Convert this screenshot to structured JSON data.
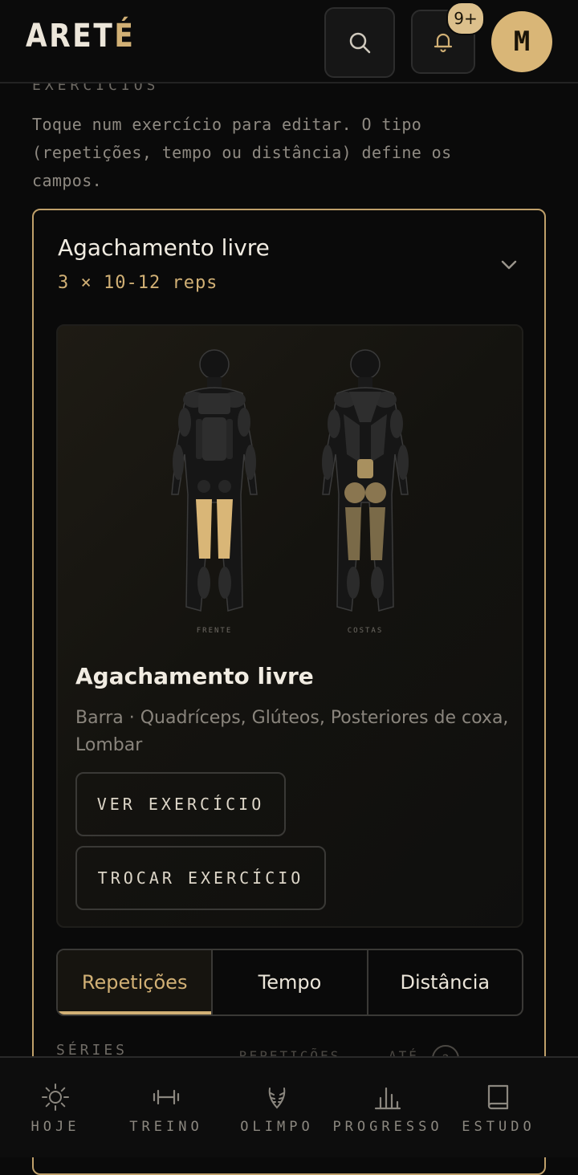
{
  "app": {
    "logo_main": "ARET",
    "logo_accent": "É"
  },
  "header": {
    "notification_badge": "9+",
    "avatar_initial": "M"
  },
  "section": {
    "label": "EXERCÍCIOS",
    "intro": "Toque num exercício para editar. O tipo (repetições, tempo ou distância) define os campos."
  },
  "exercise": {
    "title": "Agachamento livre",
    "prescription": "3 × 10-12 reps",
    "diagram": {
      "front_label": "FRENTE",
      "back_label": "COSTAS"
    },
    "detail_title": "Agachamento livre",
    "detail_meta": "Barra · Quadríceps, Glúteos, Posteriores de coxa, Lombar",
    "view_button": "VER EXERCÍCIO",
    "swap_button": "TROCAR EXERCÍCIO",
    "tabs": [
      {
        "label": "Repetições",
        "active": true
      },
      {
        "label": "Tempo",
        "active": false
      },
      {
        "label": "Distância",
        "active": false
      }
    ],
    "series_label": "SÉRIES",
    "reps_label": "REPETIÇÕES",
    "until_label": "ATÉ",
    "help_icon": "?"
  },
  "nav": [
    {
      "label": "HOJE",
      "icon": "sun-icon"
    },
    {
      "label": "TREINO",
      "icon": "dumbbell-icon"
    },
    {
      "label": "OLIMPO",
      "icon": "laurel-icon"
    },
    {
      "label": "PROGRESSO",
      "icon": "chart-icon"
    },
    {
      "label": "ESTUDO",
      "icon": "book-icon"
    }
  ],
  "colors": {
    "accent": "#d1b075",
    "background": "#0a0a0a",
    "highlight_primary": "#d9b677",
    "highlight_secondary": "#7a6a48"
  }
}
